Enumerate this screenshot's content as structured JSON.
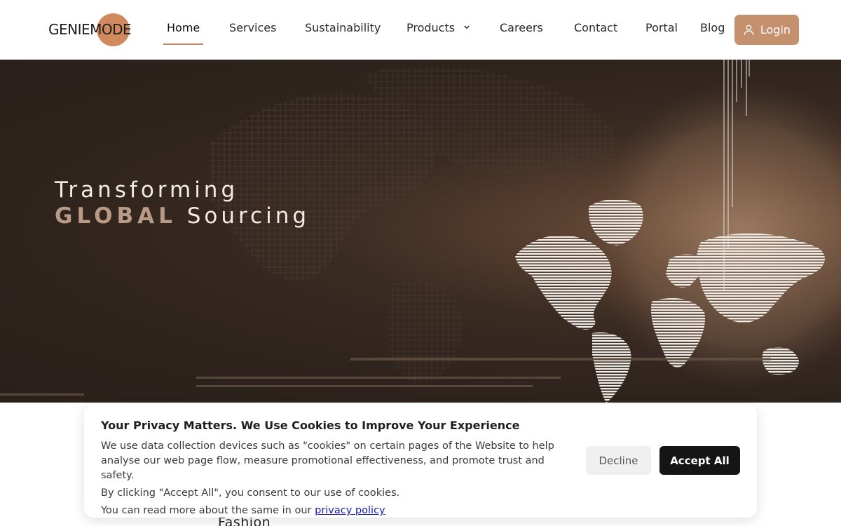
{
  "brand": {
    "logo_text": "GENIEMODE",
    "accent_color": "#c4906d"
  },
  "nav": {
    "items": [
      {
        "label": "Home",
        "active": true
      },
      {
        "label": "Services"
      },
      {
        "label": "Sustainability"
      },
      {
        "label": "Products",
        "has_dropdown": true
      },
      {
        "label": "Careers"
      },
      {
        "label": "Contact"
      },
      {
        "label": "Portal"
      },
      {
        "label": "Blog"
      }
    ],
    "login_label": "Login"
  },
  "hero": {
    "line1": "Transforming",
    "line2_accent": "GLOBAL",
    "line2_rest": "Sourcing"
  },
  "below": {
    "partial_heading": "Fashion"
  },
  "cookie": {
    "title": "Your Privacy Matters. We Use Cookies to Improve Your Experience",
    "body1": "We use data collection devices such as \"cookies\" on certain pages of the Website to help analyse our web page flow, measure promotional effectiveness, and promote trust and safety.",
    "body2": "By clicking \"Accept All\", you consent to our use of cookies.",
    "body3_prefix": "You can read more about the same in our ",
    "link_text": "privacy policy",
    "decline_label": "Decline",
    "accept_label": "Accept All"
  }
}
